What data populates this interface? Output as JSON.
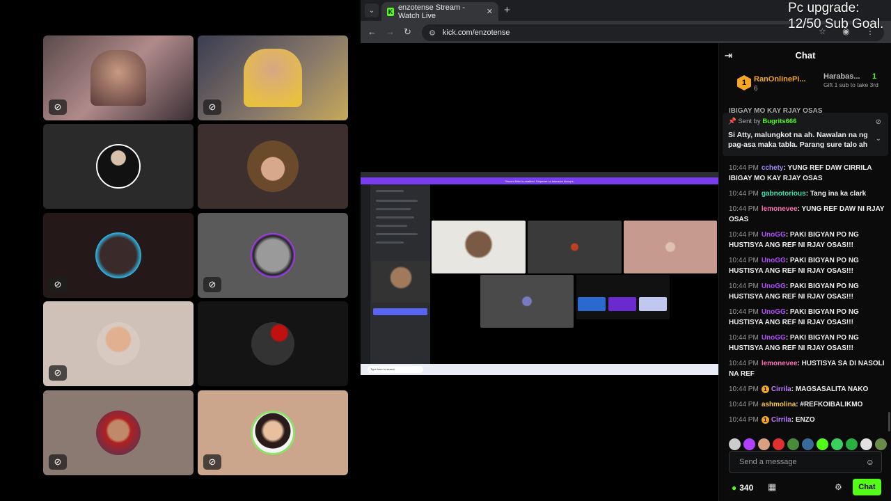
{
  "overlay": {
    "goal_line1": "Pc upgrade:",
    "goal_line2": "12/50 Sub Goal."
  },
  "browser": {
    "tab_title": "enzotense Stream - Watch Live",
    "tab_favicon": "K",
    "url": "kick.com/enzotense",
    "new_tab_icon": "+",
    "icons": [
      "back-arrow-icon",
      "forward-arrow-icon",
      "reload-icon",
      "tune-icon",
      "star-icon",
      "profile-icon",
      "menu-icon"
    ]
  },
  "stream_screen": {
    "discord_banner": "Discord Nitro is enabled. Dispense so intensive hiccups.",
    "taskbar_search": "Type here to search"
  },
  "chat": {
    "title": "Chat",
    "leaderboard": [
      {
        "rank": "1",
        "name": "RanOnlinePi...",
        "count": "6"
      },
      {
        "name": "Harabas...",
        "count": "1",
        "sub": "Gift 1 sub to take 3rd"
      }
    ],
    "hidden_preview": "IBIGAY MO KAY RJAY OSAS",
    "pinned": {
      "sent_by_label": "Sent by",
      "user": "Bugrits666",
      "text": "Si Atty, malungkot na ah. Nawalan na ng pag-asa maka tabla. Parang sure talo ah"
    },
    "messages": [
      {
        "time": "10:44 PM",
        "user": "cchety",
        "color": "#9b8cff",
        "text": "YUNG REF DAW CIRRILA IBIGAY MO KAY RJAY OSAS"
      },
      {
        "time": "10:44 PM",
        "user": "gabnotorious",
        "color": "#40e0b0",
        "text": "Tang ina ka clark"
      },
      {
        "time": "10:44 PM",
        "user": "lemonevee",
        "color": "#ff6fb5",
        "text": "YUNG REF DAW NI RJAY OSAS"
      },
      {
        "time": "10:44 PM",
        "user": "UnoGG",
        "color": "#b44bff",
        "text": "PAKI BIGYAN PO NG HUSTISYA ANG REF NI RJAY OSAS!!!"
      },
      {
        "time": "10:44 PM",
        "user": "UnoGG",
        "color": "#b44bff",
        "text": "PAKI BIGYAN PO NG HUSTISYA ANG REF NI RJAY OSAS!!!"
      },
      {
        "time": "10:44 PM",
        "user": "UnoGG",
        "color": "#b44bff",
        "text": "PAKI BIGYAN PO NG HUSTISYA ANG REF NI RJAY OSAS!!!"
      },
      {
        "time": "10:44 PM",
        "user": "UnoGG",
        "color": "#b44bff",
        "text": "PAKI BIGYAN PO NG HUSTISYA ANG REF NI RJAY OSAS!!!"
      },
      {
        "time": "10:44 PM",
        "user": "UnoGG",
        "color": "#b44bff",
        "text": "PAKI BIGYAN PO NG HUSTISYA ANG REF NI RJAY OSAS!!!"
      },
      {
        "time": "10:44 PM",
        "user": "lemonevee",
        "color": "#ff6fb5",
        "text": "HUSTISYA SA DI NASOLI NA REF"
      },
      {
        "time": "10:44 PM",
        "user": "Cirrila",
        "color": "#c07bff",
        "badge": "1",
        "text": "MAGSASALITA NAKO"
      },
      {
        "time": "10:44 PM",
        "user": "ashmolina",
        "color": "#f5c542",
        "text": "#REFKOIBALIKMO"
      },
      {
        "time": "10:44 PM",
        "user": "Cirrila",
        "color": "#c07bff",
        "badge": "1",
        "text": "ENZO"
      }
    ],
    "input_placeholder": "Send a message",
    "points": "340",
    "send_button": "Chat"
  }
}
